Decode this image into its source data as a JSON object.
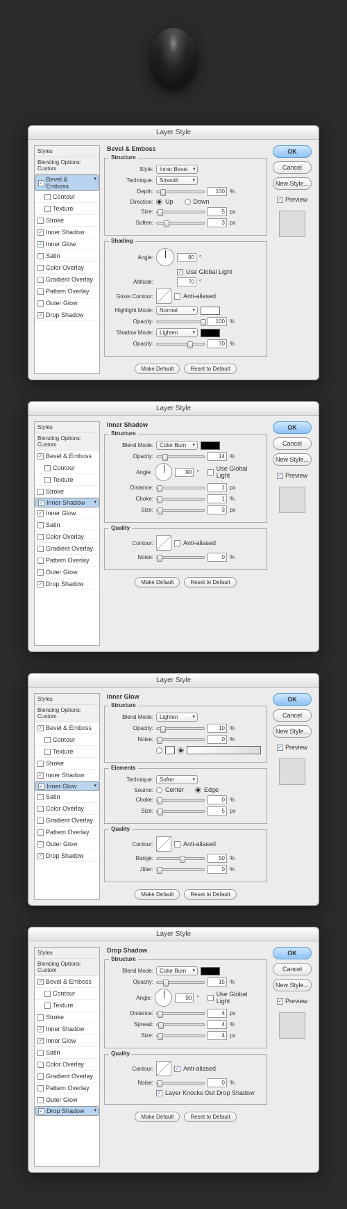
{
  "title": "Layer Style",
  "sidebar": {
    "head1": "Styles",
    "head2": "Blending Options: Custom",
    "items": [
      {
        "label": "Bevel & Emboss",
        "checked": true
      },
      {
        "label": "Contour",
        "checked": false,
        "sub": true
      },
      {
        "label": "Texture",
        "checked": false,
        "sub": true
      },
      {
        "label": "Stroke",
        "checked": false
      },
      {
        "label": "Inner Shadow",
        "checked": true
      },
      {
        "label": "Inner Glow",
        "checked": true
      },
      {
        "label": "Satin",
        "checked": false
      },
      {
        "label": "Color Overlay",
        "checked": false
      },
      {
        "label": "Gradient Overlay",
        "checked": false
      },
      {
        "label": "Pattern Overlay",
        "checked": false
      },
      {
        "label": "Outer Glow",
        "checked": false
      },
      {
        "label": "Drop Shadow",
        "checked": true
      }
    ]
  },
  "buttons": {
    "ok": "OK",
    "cancel": "Cancel",
    "newstyle": "New Style...",
    "preview": "Preview",
    "makedef": "Make Default",
    "resetdef": "Reset to Default"
  },
  "labels": {
    "style": "Style:",
    "technique": "Technique:",
    "depth": "Depth:",
    "direction": "Direction:",
    "up": "Up",
    "down": "Down",
    "size": "Size:",
    "soften": "Soften:",
    "angle": "Angle:",
    "altitude": "Altitude:",
    "glosscontour": "Gloss Contour:",
    "antialiased": "Anti-aliased",
    "highlightmode": "Highlight Mode:",
    "opacity": "Opacity:",
    "shadowmode": "Shadow Mode:",
    "useglobal": "Use Global Light",
    "blendmode": "Blend Mode:",
    "distance": "Distance:",
    "choke": "Choke:",
    "contour": "Contour:",
    "noise": "Noise:",
    "source": "Source:",
    "center": "Center",
    "edge": "Edge",
    "spread": "Spread:",
    "range": "Range:",
    "jitter": "Jitter:",
    "knockout": "Layer Knocks Out Drop Shadow",
    "pct": "%",
    "px": "px",
    "deg": "°"
  },
  "sections": {
    "bevel": "Bevel & Emboss",
    "structure": "Structure",
    "shading": "Shading",
    "innershadow": "Inner Shadow",
    "innerglow": "Inner Glow",
    "dropshadow": "Drop Shadow",
    "quality": "Quality",
    "elements": "Elements"
  },
  "d1": {
    "style": "Inner Bevel",
    "technique": "Smooth",
    "depth": "100",
    "size": "5",
    "soften": "3",
    "angle": "80",
    "altitude": "70",
    "hlmode": "Normal",
    "hlopacity": "100",
    "shmode": "Lighten",
    "shopacity": "70",
    "useglobal": true
  },
  "d2": {
    "blendmode": "Color Burn",
    "opacity": "14",
    "angle": "90",
    "distance": "1",
    "choke": "1",
    "size": "3",
    "noise": "0",
    "useglobal": false
  },
  "d3": {
    "blendmode": "Lighten",
    "opacity": "10",
    "noise": "0",
    "technique": "Softer",
    "choke": "0",
    "size": "5",
    "range": "50",
    "jitter": "0"
  },
  "d4": {
    "blendmode": "Color Burn",
    "opacity": "15",
    "angle": "90",
    "distance": "4",
    "spread": "4",
    "size": "4",
    "noise": "0",
    "useglobal": false,
    "antialiased": true,
    "knockout": true
  }
}
